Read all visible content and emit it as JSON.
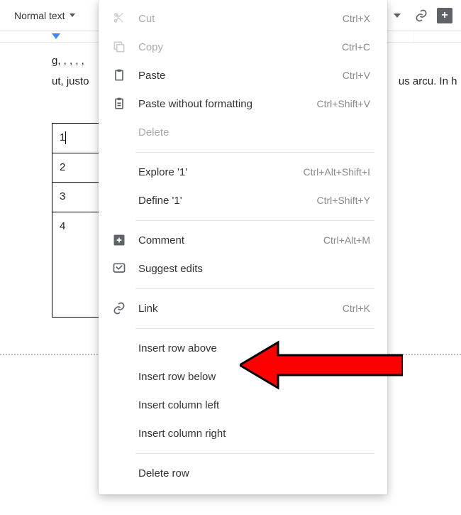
{
  "toolbar": {
    "style_label": "Normal text"
  },
  "document": {
    "line1_suffix": "g,   ,       ,              ,    ,",
    "line2_prefix": "ut, justo",
    "line2_suffix": "us arcu. In h",
    "table_cells": [
      "1",
      "2",
      "3",
      "4"
    ]
  },
  "menu": [
    {
      "icon": "cut",
      "label": "Cut",
      "shortcut": "Ctrl+X",
      "disabled": true
    },
    {
      "icon": "copy",
      "label": "Copy",
      "shortcut": "Ctrl+C",
      "disabled": true
    },
    {
      "icon": "paste",
      "label": "Paste",
      "shortcut": "Ctrl+V"
    },
    {
      "icon": "paste-plain",
      "label": "Paste without formatting",
      "shortcut": "Ctrl+Shift+V"
    },
    {
      "icon": "",
      "label": "Delete",
      "shortcut": "",
      "disabled": true
    },
    {
      "sep": true
    },
    {
      "icon": "",
      "label": "Explore '1'",
      "shortcut": "Ctrl+Alt+Shift+I"
    },
    {
      "icon": "",
      "label": "Define '1'",
      "shortcut": "Ctrl+Shift+Y"
    },
    {
      "sep": true
    },
    {
      "icon": "comment",
      "label": "Comment",
      "shortcut": "Ctrl+Alt+M"
    },
    {
      "icon": "suggest",
      "label": "Suggest edits",
      "shortcut": ""
    },
    {
      "sep": true
    },
    {
      "icon": "link",
      "label": "Link",
      "shortcut": "Ctrl+K"
    },
    {
      "sep": true
    },
    {
      "icon": "",
      "label": "Insert row above",
      "shortcut": ""
    },
    {
      "icon": "",
      "label": "Insert row below",
      "shortcut": ""
    },
    {
      "icon": "",
      "label": "Insert column left",
      "shortcut": ""
    },
    {
      "icon": "",
      "label": "Insert column right",
      "shortcut": ""
    },
    {
      "sep": true
    },
    {
      "icon": "",
      "label": "Delete row",
      "shortcut": ""
    }
  ]
}
